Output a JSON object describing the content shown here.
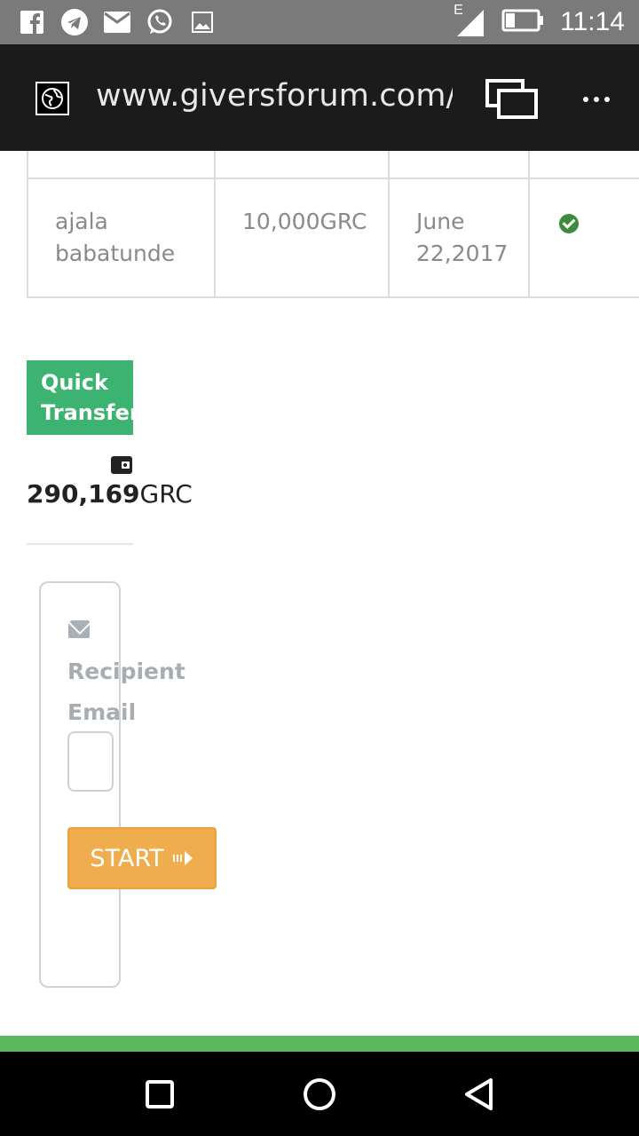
{
  "status_bar": {
    "time": "11:14",
    "network": "E",
    "left_icons": [
      "facebook-icon",
      "telegram-icon",
      "mail-icon",
      "whatsapp-icon",
      "gallery-icon"
    ]
  },
  "browser": {
    "url": "www.giversforum.com/o"
  },
  "table": {
    "row": {
      "name": "ajala babatunde",
      "amount": "10,000GRC",
      "date": "June 22,2017",
      "status": "check-circle-icon"
    }
  },
  "quick_transfer": {
    "title": "Quick Transfer",
    "balance_value": "290,169",
    "balance_unit": "GRC"
  },
  "form": {
    "recipient_label": "Recipient Email",
    "email_value": "",
    "start_label": "START"
  },
  "colors": {
    "quick_transfer_bg": "#3cb371",
    "start_button_bg": "#f0ad4e",
    "footer_band": "#5cb85c"
  }
}
